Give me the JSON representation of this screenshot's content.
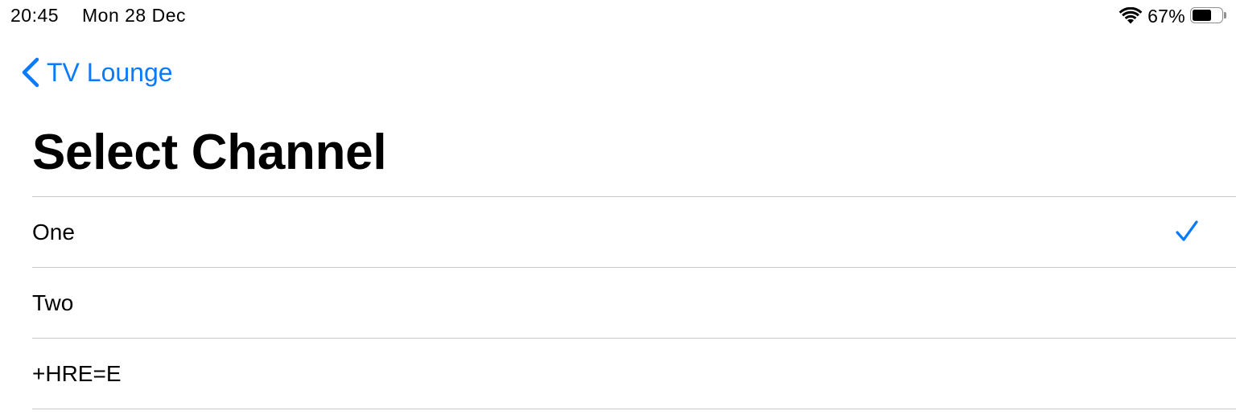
{
  "status_bar": {
    "time": "20:45",
    "date": "Mon 28 Dec",
    "battery_percent": "67%",
    "battery_level": 0.67,
    "wifi_icon": "wifi-icon",
    "battery_icon": "battery-icon"
  },
  "nav": {
    "back_label": "TV Lounge",
    "back_icon": "chevron-left-icon",
    "accent_color": "#0a7aff"
  },
  "page": {
    "title": "Select Channel"
  },
  "channels": {
    "items": [
      {
        "label": "One",
        "selected": true
      },
      {
        "label": "Two",
        "selected": false
      },
      {
        "label": "+HRE=E",
        "selected": false
      }
    ],
    "check_icon": "checkmark-icon"
  }
}
